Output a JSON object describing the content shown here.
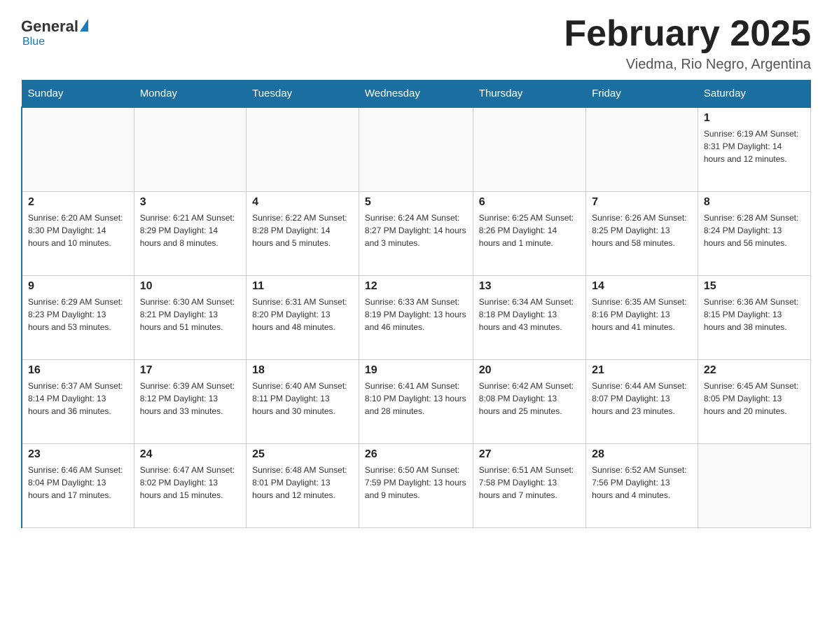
{
  "header": {
    "logo_general": "General",
    "logo_blue": "Blue",
    "title": "February 2025",
    "subtitle": "Viedma, Rio Negro, Argentina"
  },
  "days_of_week": [
    "Sunday",
    "Monday",
    "Tuesday",
    "Wednesday",
    "Thursday",
    "Friday",
    "Saturday"
  ],
  "weeks": [
    {
      "days": [
        {
          "number": "",
          "info": ""
        },
        {
          "number": "",
          "info": ""
        },
        {
          "number": "",
          "info": ""
        },
        {
          "number": "",
          "info": ""
        },
        {
          "number": "",
          "info": ""
        },
        {
          "number": "",
          "info": ""
        },
        {
          "number": "1",
          "info": "Sunrise: 6:19 AM\nSunset: 8:31 PM\nDaylight: 14 hours and 12 minutes."
        }
      ]
    },
    {
      "days": [
        {
          "number": "2",
          "info": "Sunrise: 6:20 AM\nSunset: 8:30 PM\nDaylight: 14 hours and 10 minutes."
        },
        {
          "number": "3",
          "info": "Sunrise: 6:21 AM\nSunset: 8:29 PM\nDaylight: 14 hours and 8 minutes."
        },
        {
          "number": "4",
          "info": "Sunrise: 6:22 AM\nSunset: 8:28 PM\nDaylight: 14 hours and 5 minutes."
        },
        {
          "number": "5",
          "info": "Sunrise: 6:24 AM\nSunset: 8:27 PM\nDaylight: 14 hours and 3 minutes."
        },
        {
          "number": "6",
          "info": "Sunrise: 6:25 AM\nSunset: 8:26 PM\nDaylight: 14 hours and 1 minute."
        },
        {
          "number": "7",
          "info": "Sunrise: 6:26 AM\nSunset: 8:25 PM\nDaylight: 13 hours and 58 minutes."
        },
        {
          "number": "8",
          "info": "Sunrise: 6:28 AM\nSunset: 8:24 PM\nDaylight: 13 hours and 56 minutes."
        }
      ]
    },
    {
      "days": [
        {
          "number": "9",
          "info": "Sunrise: 6:29 AM\nSunset: 8:23 PM\nDaylight: 13 hours and 53 minutes."
        },
        {
          "number": "10",
          "info": "Sunrise: 6:30 AM\nSunset: 8:21 PM\nDaylight: 13 hours and 51 minutes."
        },
        {
          "number": "11",
          "info": "Sunrise: 6:31 AM\nSunset: 8:20 PM\nDaylight: 13 hours and 48 minutes."
        },
        {
          "number": "12",
          "info": "Sunrise: 6:33 AM\nSunset: 8:19 PM\nDaylight: 13 hours and 46 minutes."
        },
        {
          "number": "13",
          "info": "Sunrise: 6:34 AM\nSunset: 8:18 PM\nDaylight: 13 hours and 43 minutes."
        },
        {
          "number": "14",
          "info": "Sunrise: 6:35 AM\nSunset: 8:16 PM\nDaylight: 13 hours and 41 minutes."
        },
        {
          "number": "15",
          "info": "Sunrise: 6:36 AM\nSunset: 8:15 PM\nDaylight: 13 hours and 38 minutes."
        }
      ]
    },
    {
      "days": [
        {
          "number": "16",
          "info": "Sunrise: 6:37 AM\nSunset: 8:14 PM\nDaylight: 13 hours and 36 minutes."
        },
        {
          "number": "17",
          "info": "Sunrise: 6:39 AM\nSunset: 8:12 PM\nDaylight: 13 hours and 33 minutes."
        },
        {
          "number": "18",
          "info": "Sunrise: 6:40 AM\nSunset: 8:11 PM\nDaylight: 13 hours and 30 minutes."
        },
        {
          "number": "19",
          "info": "Sunrise: 6:41 AM\nSunset: 8:10 PM\nDaylight: 13 hours and 28 minutes."
        },
        {
          "number": "20",
          "info": "Sunrise: 6:42 AM\nSunset: 8:08 PM\nDaylight: 13 hours and 25 minutes."
        },
        {
          "number": "21",
          "info": "Sunrise: 6:44 AM\nSunset: 8:07 PM\nDaylight: 13 hours and 23 minutes."
        },
        {
          "number": "22",
          "info": "Sunrise: 6:45 AM\nSunset: 8:05 PM\nDaylight: 13 hours and 20 minutes."
        }
      ]
    },
    {
      "days": [
        {
          "number": "23",
          "info": "Sunrise: 6:46 AM\nSunset: 8:04 PM\nDaylight: 13 hours and 17 minutes."
        },
        {
          "number": "24",
          "info": "Sunrise: 6:47 AM\nSunset: 8:02 PM\nDaylight: 13 hours and 15 minutes."
        },
        {
          "number": "25",
          "info": "Sunrise: 6:48 AM\nSunset: 8:01 PM\nDaylight: 13 hours and 12 minutes."
        },
        {
          "number": "26",
          "info": "Sunrise: 6:50 AM\nSunset: 7:59 PM\nDaylight: 13 hours and 9 minutes."
        },
        {
          "number": "27",
          "info": "Sunrise: 6:51 AM\nSunset: 7:58 PM\nDaylight: 13 hours and 7 minutes."
        },
        {
          "number": "28",
          "info": "Sunrise: 6:52 AM\nSunset: 7:56 PM\nDaylight: 13 hours and 4 minutes."
        },
        {
          "number": "",
          "info": ""
        }
      ]
    }
  ]
}
